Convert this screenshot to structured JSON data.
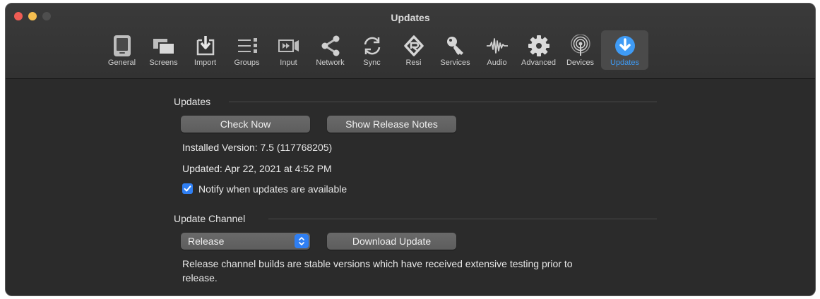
{
  "window": {
    "title": "Updates"
  },
  "toolbar": {
    "items": [
      {
        "label": "General",
        "icon": "tablet-icon"
      },
      {
        "label": "Screens",
        "icon": "screens-icon"
      },
      {
        "label": "Import",
        "icon": "import-icon"
      },
      {
        "label": "Groups",
        "icon": "groups-icon"
      },
      {
        "label": "Input",
        "icon": "input-icon"
      },
      {
        "label": "Network",
        "icon": "share-icon"
      },
      {
        "label": "Sync",
        "icon": "sync-icon"
      },
      {
        "label": "Resi",
        "icon": "resi-icon"
      },
      {
        "label": "Services",
        "icon": "key-icon"
      },
      {
        "label": "Audio",
        "icon": "waveform-icon"
      },
      {
        "label": "Advanced",
        "icon": "gear-icon"
      },
      {
        "label": "Devices",
        "icon": "broadcast-icon"
      },
      {
        "label": "Updates",
        "icon": "download-icon",
        "selected": true
      }
    ],
    "accent": "#3f9bf5"
  },
  "updates": {
    "heading": "Updates",
    "check_now": "Check Now",
    "show_release_notes": "Show Release Notes",
    "installed_version": "Installed Version: 7.5 (117768205)",
    "updated": "Updated: Apr 22, 2021 at 4:52 PM",
    "notify_label": "Notify when updates are available",
    "notify_checked": true
  },
  "channel": {
    "heading": "Update Channel",
    "selected": "Release",
    "download_update": "Download Update",
    "description_line1": "Release channel builds are stable versions which have received extensive testing prior to",
    "description_line2": "release."
  }
}
